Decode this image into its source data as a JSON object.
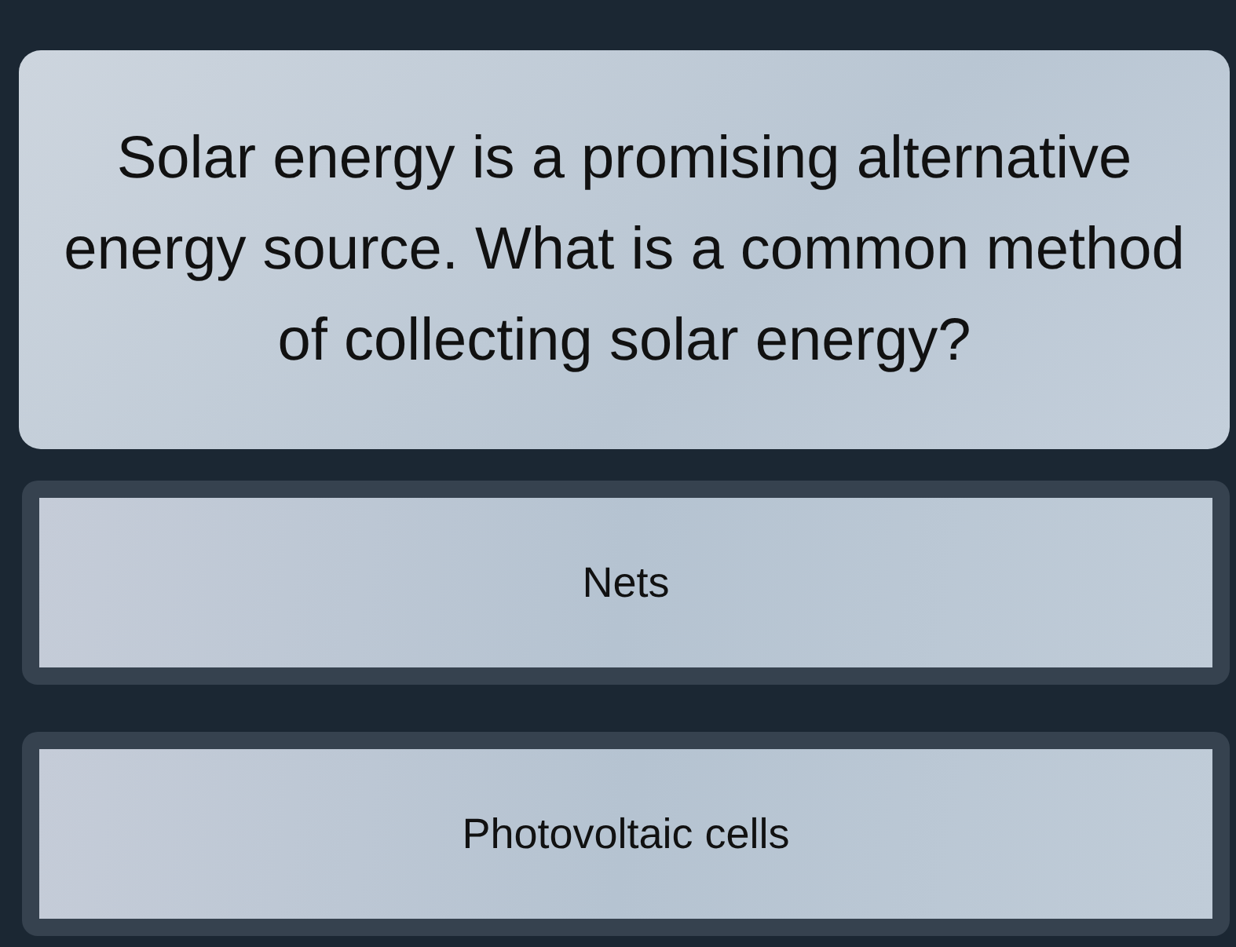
{
  "question": {
    "text": "Solar energy is a promising alternative energy source. What is a common method of collecting solar energy?"
  },
  "options": [
    {
      "label": "Nets"
    },
    {
      "label": "Photovoltaic cells"
    }
  ]
}
